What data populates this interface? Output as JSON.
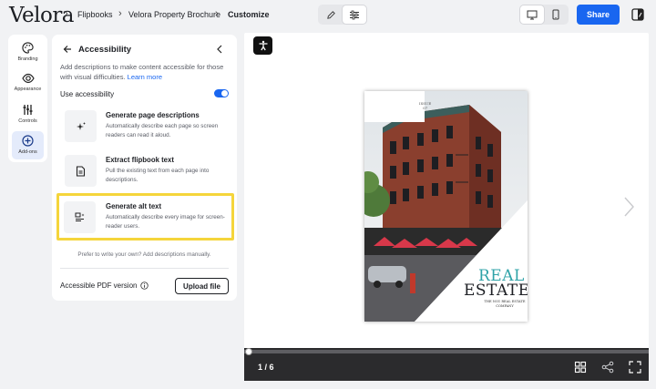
{
  "app": {
    "logo": "Velora",
    "breadcrumb": [
      "Flipbooks",
      "Velora Property Brochure",
      "Customize"
    ],
    "share_label": "Share"
  },
  "rail": {
    "items": [
      {
        "label": "Branding",
        "icon": "palette-icon"
      },
      {
        "label": "Appearance",
        "icon": "eye-icon"
      },
      {
        "label": "Controls",
        "icon": "sliders-icon"
      },
      {
        "label": "Add-ons",
        "icon": "plus-circle-icon",
        "active": true
      }
    ]
  },
  "panel": {
    "title": "Accessibility",
    "description": "Add descriptions to make content accessible for those with visual difficulties.",
    "learn_more": "Learn more",
    "use_accessibility_label": "Use accessibility",
    "use_accessibility_on": true,
    "options": [
      {
        "title": "Generate page descriptions",
        "subtitle": "Automatically describe each page so screen readers can read it aloud.",
        "icon": "sparkle-icon"
      },
      {
        "title": "Extract flipbook text",
        "subtitle": "Pull the existing text from each page into descriptions.",
        "icon": "document-icon"
      },
      {
        "title": "Generate alt text",
        "subtitle": "Automatically describe every image for screen-reader users.",
        "icon": "alt-text-icon",
        "highlighted": true
      }
    ],
    "manual_note": "Prefer to write your own? Add descriptions manually.",
    "pdf_label": "Accessible PDF version",
    "upload_label": "Upload file"
  },
  "preview": {
    "cover": {
      "issue_line1": "ISSUE",
      "issue_line2": "07",
      "title_line1": "REAL",
      "title_line2": "ESTATE",
      "subtitle": "THE NO1 REAL ESTATE COMPANY"
    },
    "page_indicator": "1 / 6",
    "progress": 0.0
  },
  "colors": {
    "accent": "#1966f0",
    "highlight": "#f5d53b",
    "teal_title": "#2fa3a8"
  }
}
